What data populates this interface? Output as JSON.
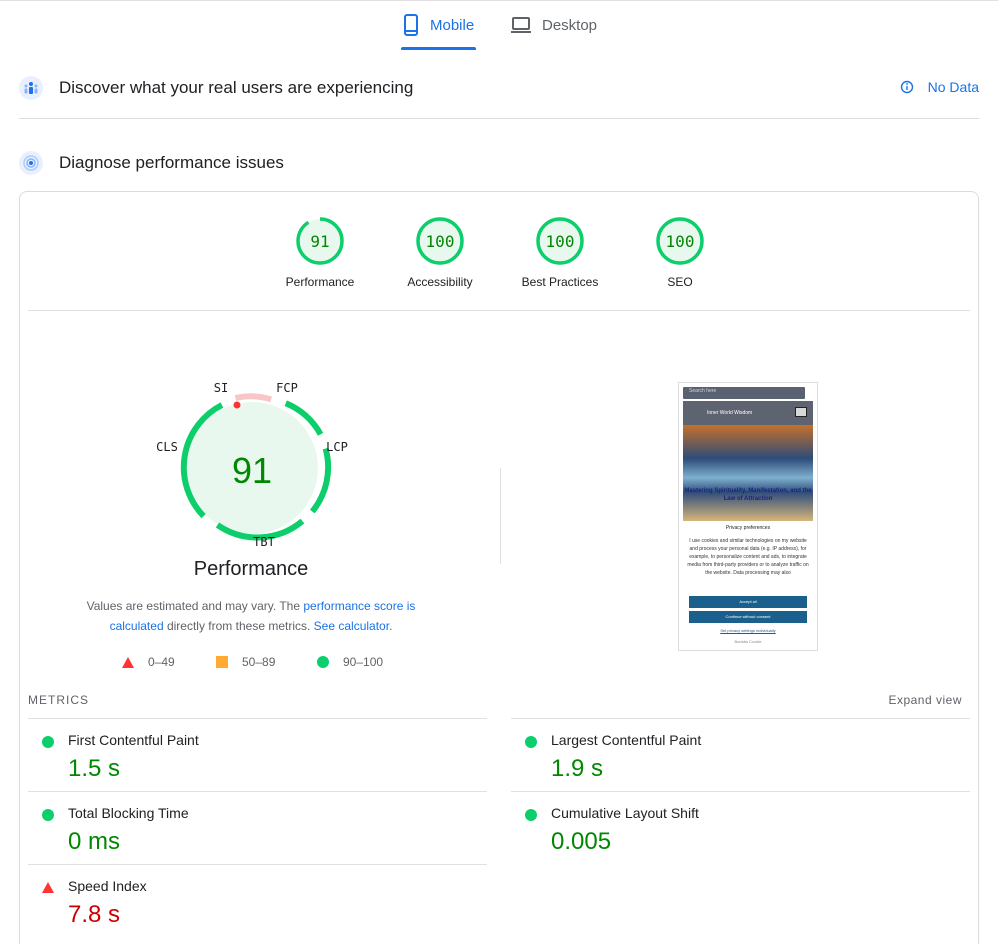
{
  "tabs": [
    {
      "label": "Mobile",
      "icon": "smartphone-icon",
      "active": true
    },
    {
      "label": "Desktop",
      "icon": "laptop-icon",
      "active": false
    }
  ],
  "field_data": {
    "title": "Discover what your real users are experiencing",
    "status": "No Data",
    "status_icon": "info-icon"
  },
  "lab_data": {
    "title": "Diagnose performance issues"
  },
  "categories": [
    {
      "label": "Performance",
      "score": "91",
      "fraction": 0.91
    },
    {
      "label": "Accessibility",
      "score": "100",
      "fraction": 1.0
    },
    {
      "label": "Best Practices",
      "score": "100",
      "fraction": 1.0
    },
    {
      "label": "SEO",
      "score": "100",
      "fraction": 1.0
    }
  ],
  "performance": {
    "score": "91",
    "title": "Performance",
    "gauge_labels": {
      "si": "SI",
      "fcp": "FCP",
      "lcp": "LCP",
      "tbt": "TBT",
      "cls": "CLS"
    },
    "note_prefix": "Values are estimated and may vary. The ",
    "note_link1": "performance score is calculated",
    "note_middle": " directly from these metrics. ",
    "note_link2": "See calculator",
    "note_suffix": "."
  },
  "legend": [
    {
      "range": "0–49",
      "shape": "triangle",
      "color": "#ff3333"
    },
    {
      "range": "50–89",
      "shape": "square",
      "color": "#ffaa33"
    },
    {
      "range": "90–100",
      "shape": "circle",
      "color": "#0cce6b"
    }
  ],
  "thumbnail": {
    "search_placeholder": "Search here",
    "site_name": "Inner World Wisdom",
    "hero_title": "Mastering Spirituality, Manifestation, and the Law of Attraction",
    "modal_title": "Privacy preferences",
    "modal_text": "I use cookies and similar technologies on my website and process your personal data (e.g. IP address), for example, to personalize content and ads, to integrate media from third-party providers or to analyze traffic on the website. Data processing may also",
    "accept_label": "Accept all",
    "continue_label": "Continue without consent",
    "settings_link": "Set privacy settings individually",
    "footer": "Borlabs Cookie"
  },
  "metrics": {
    "label": "METRICS",
    "expand": "Expand view",
    "items": [
      {
        "name": "First Contentful Paint",
        "value": "1.5 s",
        "rating": "good"
      },
      {
        "name": "Largest Contentful Paint",
        "value": "1.9 s",
        "rating": "good"
      },
      {
        "name": "Total Blocking Time",
        "value": "0 ms",
        "rating": "good"
      },
      {
        "name": "Cumulative Layout Shift",
        "value": "0.005",
        "rating": "good"
      },
      {
        "name": "Speed Index",
        "value": "7.8 s",
        "rating": "bad"
      }
    ]
  },
  "colors": {
    "accent": "#1a73e8",
    "pass": "#0cce6b",
    "pass_text": "#008800",
    "fail": "#ff3333",
    "fail_text": "#cc0000",
    "average": "#ffaa33"
  }
}
